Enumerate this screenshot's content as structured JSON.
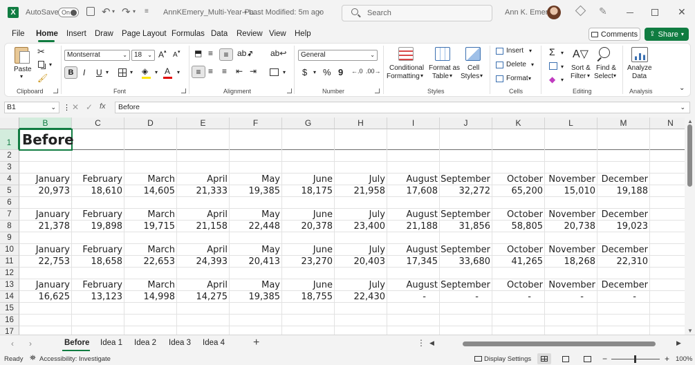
{
  "titlebar": {
    "autosave_label": "AutoSave",
    "autosave_state": "On",
    "filename": "AnnKEmery_Multi-Year-Pa...",
    "modified": "• Last Modified: 5m ago",
    "search_placeholder": "Search",
    "user_name": "Ann K. Emery"
  },
  "menu": {
    "items": [
      "File",
      "Home",
      "Insert",
      "Draw",
      "Page Layout",
      "Formulas",
      "Data",
      "Review",
      "View",
      "Help"
    ],
    "active": "Home",
    "comments_label": "Comments",
    "share_label": "Share"
  },
  "ribbon": {
    "clipboard": {
      "paste_label": "Paste",
      "group_label": "Clipboard"
    },
    "font": {
      "font_name": "Montserrat",
      "font_size": "18",
      "group_label": "Font",
      "bold": "B",
      "italic": "I",
      "underline": "U",
      "grow": "A",
      "shrink": "A"
    },
    "alignment": {
      "group_label": "Alignment"
    },
    "number": {
      "format": "General",
      "currency": "$",
      "percent": "%",
      "comma": "9",
      "group_label": "Number"
    },
    "styles": {
      "conditional": [
        "Conditional",
        "Formatting"
      ],
      "format_table": [
        "Format as",
        "Table"
      ],
      "cell_styles": [
        "Cell",
        "Styles"
      ],
      "group_label": "Styles"
    },
    "cells": {
      "insert": "Insert",
      "delete": "Delete",
      "format": "Format",
      "group_label": "Cells"
    },
    "editing": {
      "sort": [
        "Sort &",
        "Filter"
      ],
      "find": [
        "Find &",
        "Select"
      ],
      "group_label": "Editing",
      "sigma": "Σ"
    },
    "analysis": {
      "analyze": [
        "Analyze",
        "Data"
      ],
      "group_label": "Analysis"
    }
  },
  "formula": {
    "name_box": "B1",
    "fx": "fx",
    "content": "Before"
  },
  "grid": {
    "columns": [
      "B",
      "C",
      "D",
      "E",
      "F",
      "G",
      "H",
      "I",
      "J",
      "K",
      "L",
      "M",
      "N"
    ],
    "rows": [
      "1",
      "2",
      "3",
      "4",
      "5",
      "6",
      "7",
      "8",
      "9",
      "10",
      "11",
      "12",
      "13",
      "14",
      "15",
      "16",
      "17"
    ],
    "b1": "Before",
    "months": [
      "January",
      "February",
      "March",
      "April",
      "May",
      "June",
      "July",
      "August",
      "September",
      "October",
      "November",
      "December"
    ],
    "data_rows": [
      {
        "values": [
          "20,973",
          "18,610",
          "14,605",
          "21,333",
          "19,385",
          "18,175",
          "21,958",
          "17,608",
          "32,272",
          "65,200",
          "15,010",
          "19,188"
        ]
      },
      {
        "values": [
          "21,378",
          "19,898",
          "19,715",
          "21,158",
          "22,448",
          "20,378",
          "23,400",
          "21,188",
          "31,856",
          "58,805",
          "20,738",
          "19,023"
        ]
      },
      {
        "values": [
          "22,753",
          "18,658",
          "22,653",
          "24,393",
          "20,413",
          "23,270",
          "20,403",
          "17,345",
          "33,680",
          "41,265",
          "18,268",
          "22,310"
        ]
      },
      {
        "values": [
          "16,625",
          "13,123",
          "14,998",
          "14,275",
          "19,385",
          "18,755",
          "22,430",
          "-",
          "-",
          "-",
          "-",
          "-"
        ]
      }
    ]
  },
  "sheets": {
    "tabs": [
      "Before",
      "Idea 1",
      "Idea 2",
      "Idea 3",
      "Idea 4"
    ],
    "active": "Before",
    "add": "+"
  },
  "status": {
    "ready": "Ready",
    "accessibility": "Accessibility: Investigate",
    "display_settings": "Display Settings",
    "zoom": "100%",
    "zoom_minus": "−",
    "zoom_plus": "+"
  },
  "colors": {
    "excel_green": "#107c41",
    "selection_header": "#d3ecdd"
  }
}
